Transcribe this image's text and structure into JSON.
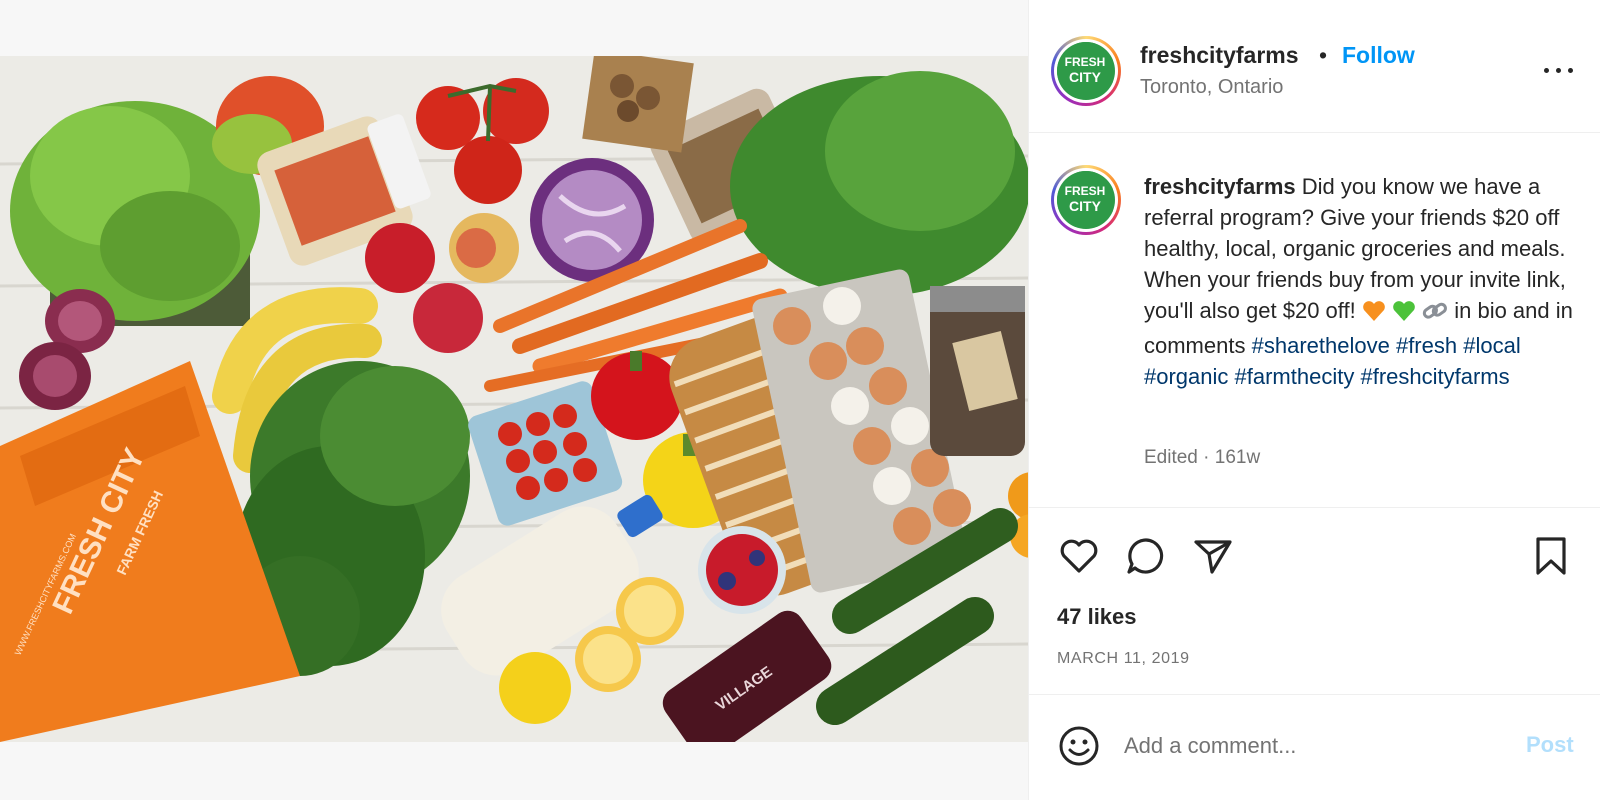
{
  "post": {
    "username": "freshcityfarms",
    "separator": "•",
    "follow_label": "Follow",
    "location": "Toronto, Ontario",
    "avatar_logo_text_top": "FRESH",
    "avatar_logo_text_bottom": "CITY",
    "image_alt": "Flat lay of fresh produce, groceries and an orange Fresh City tote bag",
    "bag_text_1": "FARM FRESH",
    "bag_text_2": "FRESH CITY",
    "bag_text_3": "WWW.FRESHCITYFARMS.COM",
    "bottle_text": "VILLAGE"
  },
  "caption": {
    "username": "freshcityfarms",
    "text": "Did you know we have a referral program? Give your friends $20 off healthy, local, organic groceries and meals. When your friends buy from your invite link, you'll also get $20 off!",
    "emojis": [
      "orange-heart",
      "green-heart",
      "link"
    ],
    "text_after_emoji": "in bio and in comments",
    "hashtags": [
      "#sharethelove",
      "#fresh",
      "#local",
      "#organic",
      "#farmthecity",
      "#freshcityfarms"
    ],
    "edited": "Edited · 161w"
  },
  "stats": {
    "likes": "47 likes",
    "date": "MARCH 11, 2019"
  },
  "comment": {
    "placeholder": "Add a comment...",
    "post_label": "Post"
  },
  "icons": {
    "like": "heart-icon",
    "comment": "comment-icon",
    "share": "share-icon",
    "save": "bookmark-icon",
    "emoji": "smiley-icon",
    "more": "more-icon"
  },
  "colors": {
    "follow": "#0095f6",
    "hashtag": "#00376b",
    "post_disabled": "#b2dffc",
    "brand_green": "#2e9a48"
  }
}
